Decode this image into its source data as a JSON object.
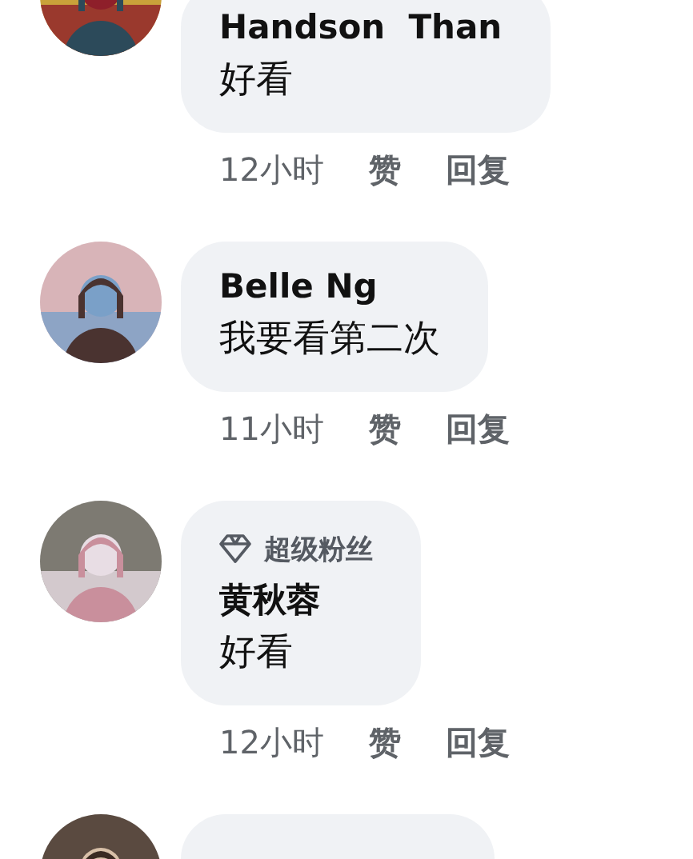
{
  "comments": [
    {
      "name": "Handson  Than",
      "text": "好看",
      "time": "12小时",
      "like": "赞",
      "reply": "回复"
    },
    {
      "name": "Belle Ng",
      "text": "我要看第二次",
      "time": "11小时",
      "like": "赞",
      "reply": "回复"
    },
    {
      "badge": "超级粉丝",
      "name": "黄秋蓉",
      "text": "好看",
      "time": "12小时",
      "like": "赞",
      "reply": "回复"
    },
    {
      "kind": "cut"
    }
  ]
}
